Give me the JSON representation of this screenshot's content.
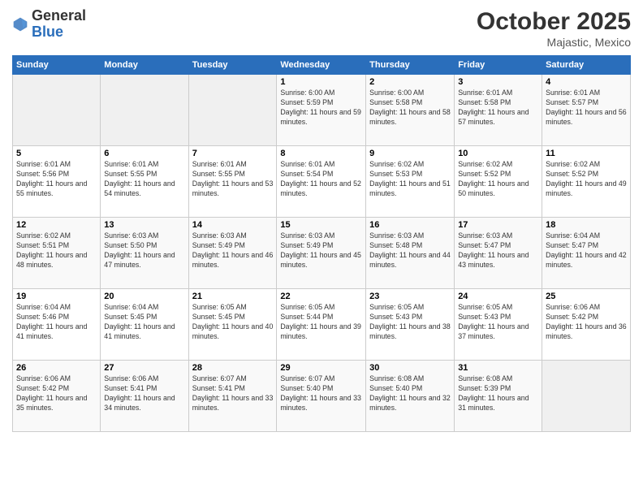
{
  "header": {
    "logo_general": "General",
    "logo_blue": "Blue",
    "month": "October 2025",
    "location": "Majastic, Mexico"
  },
  "days_of_week": [
    "Sunday",
    "Monday",
    "Tuesday",
    "Wednesday",
    "Thursday",
    "Friday",
    "Saturday"
  ],
  "weeks": [
    [
      {
        "num": "",
        "info": ""
      },
      {
        "num": "",
        "info": ""
      },
      {
        "num": "",
        "info": ""
      },
      {
        "num": "1",
        "info": "Sunrise: 6:00 AM\nSunset: 5:59 PM\nDaylight: 11 hours and 59 minutes."
      },
      {
        "num": "2",
        "info": "Sunrise: 6:00 AM\nSunset: 5:58 PM\nDaylight: 11 hours and 58 minutes."
      },
      {
        "num": "3",
        "info": "Sunrise: 6:01 AM\nSunset: 5:58 PM\nDaylight: 11 hours and 57 minutes."
      },
      {
        "num": "4",
        "info": "Sunrise: 6:01 AM\nSunset: 5:57 PM\nDaylight: 11 hours and 56 minutes."
      }
    ],
    [
      {
        "num": "5",
        "info": "Sunrise: 6:01 AM\nSunset: 5:56 PM\nDaylight: 11 hours and 55 minutes."
      },
      {
        "num": "6",
        "info": "Sunrise: 6:01 AM\nSunset: 5:55 PM\nDaylight: 11 hours and 54 minutes."
      },
      {
        "num": "7",
        "info": "Sunrise: 6:01 AM\nSunset: 5:55 PM\nDaylight: 11 hours and 53 minutes."
      },
      {
        "num": "8",
        "info": "Sunrise: 6:01 AM\nSunset: 5:54 PM\nDaylight: 11 hours and 52 minutes."
      },
      {
        "num": "9",
        "info": "Sunrise: 6:02 AM\nSunset: 5:53 PM\nDaylight: 11 hours and 51 minutes."
      },
      {
        "num": "10",
        "info": "Sunrise: 6:02 AM\nSunset: 5:52 PM\nDaylight: 11 hours and 50 minutes."
      },
      {
        "num": "11",
        "info": "Sunrise: 6:02 AM\nSunset: 5:52 PM\nDaylight: 11 hours and 49 minutes."
      }
    ],
    [
      {
        "num": "12",
        "info": "Sunrise: 6:02 AM\nSunset: 5:51 PM\nDaylight: 11 hours and 48 minutes."
      },
      {
        "num": "13",
        "info": "Sunrise: 6:03 AM\nSunset: 5:50 PM\nDaylight: 11 hours and 47 minutes."
      },
      {
        "num": "14",
        "info": "Sunrise: 6:03 AM\nSunset: 5:49 PM\nDaylight: 11 hours and 46 minutes."
      },
      {
        "num": "15",
        "info": "Sunrise: 6:03 AM\nSunset: 5:49 PM\nDaylight: 11 hours and 45 minutes."
      },
      {
        "num": "16",
        "info": "Sunrise: 6:03 AM\nSunset: 5:48 PM\nDaylight: 11 hours and 44 minutes."
      },
      {
        "num": "17",
        "info": "Sunrise: 6:03 AM\nSunset: 5:47 PM\nDaylight: 11 hours and 43 minutes."
      },
      {
        "num": "18",
        "info": "Sunrise: 6:04 AM\nSunset: 5:47 PM\nDaylight: 11 hours and 42 minutes."
      }
    ],
    [
      {
        "num": "19",
        "info": "Sunrise: 6:04 AM\nSunset: 5:46 PM\nDaylight: 11 hours and 41 minutes."
      },
      {
        "num": "20",
        "info": "Sunrise: 6:04 AM\nSunset: 5:45 PM\nDaylight: 11 hours and 41 minutes."
      },
      {
        "num": "21",
        "info": "Sunrise: 6:05 AM\nSunset: 5:45 PM\nDaylight: 11 hours and 40 minutes."
      },
      {
        "num": "22",
        "info": "Sunrise: 6:05 AM\nSunset: 5:44 PM\nDaylight: 11 hours and 39 minutes."
      },
      {
        "num": "23",
        "info": "Sunrise: 6:05 AM\nSunset: 5:43 PM\nDaylight: 11 hours and 38 minutes."
      },
      {
        "num": "24",
        "info": "Sunrise: 6:05 AM\nSunset: 5:43 PM\nDaylight: 11 hours and 37 minutes."
      },
      {
        "num": "25",
        "info": "Sunrise: 6:06 AM\nSunset: 5:42 PM\nDaylight: 11 hours and 36 minutes."
      }
    ],
    [
      {
        "num": "26",
        "info": "Sunrise: 6:06 AM\nSunset: 5:42 PM\nDaylight: 11 hours and 35 minutes."
      },
      {
        "num": "27",
        "info": "Sunrise: 6:06 AM\nSunset: 5:41 PM\nDaylight: 11 hours and 34 minutes."
      },
      {
        "num": "28",
        "info": "Sunrise: 6:07 AM\nSunset: 5:41 PM\nDaylight: 11 hours and 33 minutes."
      },
      {
        "num": "29",
        "info": "Sunrise: 6:07 AM\nSunset: 5:40 PM\nDaylight: 11 hours and 33 minutes."
      },
      {
        "num": "30",
        "info": "Sunrise: 6:08 AM\nSunset: 5:40 PM\nDaylight: 11 hours and 32 minutes."
      },
      {
        "num": "31",
        "info": "Sunrise: 6:08 AM\nSunset: 5:39 PM\nDaylight: 11 hours and 31 minutes."
      },
      {
        "num": "",
        "info": ""
      }
    ]
  ]
}
